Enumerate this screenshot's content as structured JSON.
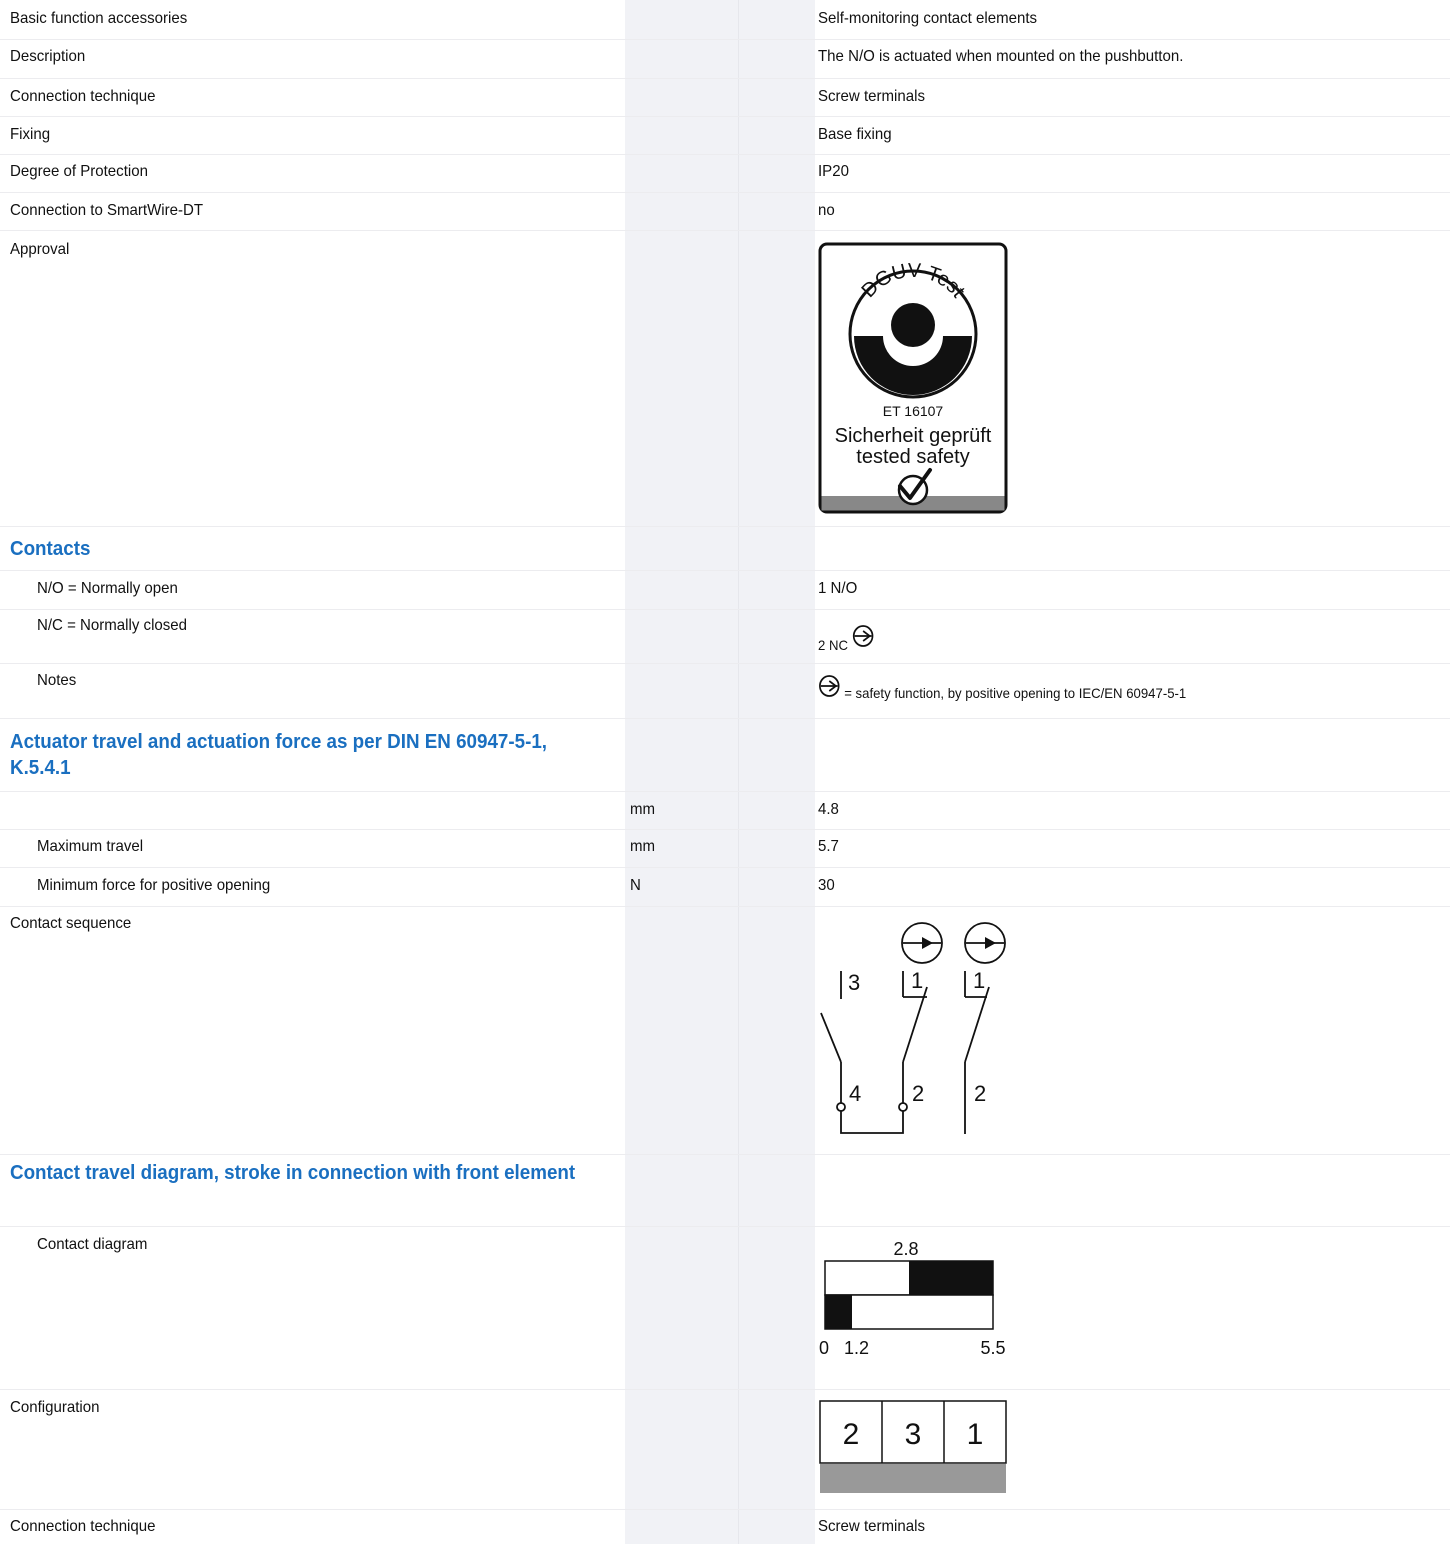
{
  "rows": {
    "basic_function": {
      "label": "Basic function accessories",
      "value": "Self-monitoring contact elements"
    },
    "description": {
      "label": "Description",
      "value": "The N/O is actuated when mounted on the pushbutton."
    },
    "connection_technique": {
      "label": "Connection technique",
      "value": "Screw terminals"
    },
    "fixing": {
      "label": "Fixing",
      "value": "Base fixing"
    },
    "degree_of_protection": {
      "label": "Degree of Protection",
      "value": "IP20"
    },
    "smartwire": {
      "label": "Connection to SmartWire-DT",
      "value": "no"
    },
    "approval": {
      "label": "Approval",
      "badge": {
        "ring_text": "DGUV Test",
        "number": "ET 16107",
        "line1": "Sicherheit geprüft",
        "line2": "tested safety"
      }
    }
  },
  "contacts": {
    "heading": "Contacts",
    "no": {
      "label": "N/O = Normally open",
      "value": "1 N/O"
    },
    "nc": {
      "label": "N/C = Normally closed",
      "value": "2 NC",
      "icon": "positive-opening-icon"
    },
    "notes": {
      "label": "Notes",
      "value": "= safety function, by positive opening to IEC/EN 60947-5-1",
      "icon": "positive-opening-icon"
    }
  },
  "actuator": {
    "heading": "Actuator travel and actuation force as per DIN EN 60947-5-1, K.5.4.1",
    "travel": {
      "label": "",
      "unit": "mm",
      "value": "4.8"
    },
    "max_travel": {
      "label": "Maximum travel",
      "unit": "mm",
      "value": "5.7"
    },
    "min_force": {
      "label": "Minimum force for positive opening",
      "unit": "N",
      "value": "30"
    }
  },
  "contact_sequence": {
    "label": "Contact sequence",
    "terminals": {
      "no_top": "3",
      "no_bottom": "4",
      "nc1_top": "1",
      "nc1_bottom": "2",
      "nc2_top": "1",
      "nc2_bottom": "2"
    }
  },
  "travel_diagram": {
    "heading": "Contact travel diagram, stroke in connection with front element",
    "label": "Contact diagram",
    "mark_top": "2.8",
    "mark_zero": "0",
    "mark_left": "1.2",
    "mark_end": "5.5"
  },
  "configuration": {
    "label": "Configuration",
    "cells": [
      "2",
      "3",
      "1"
    ]
  },
  "footer_row": {
    "label": "Connection technique",
    "value": "Screw terminals"
  }
}
